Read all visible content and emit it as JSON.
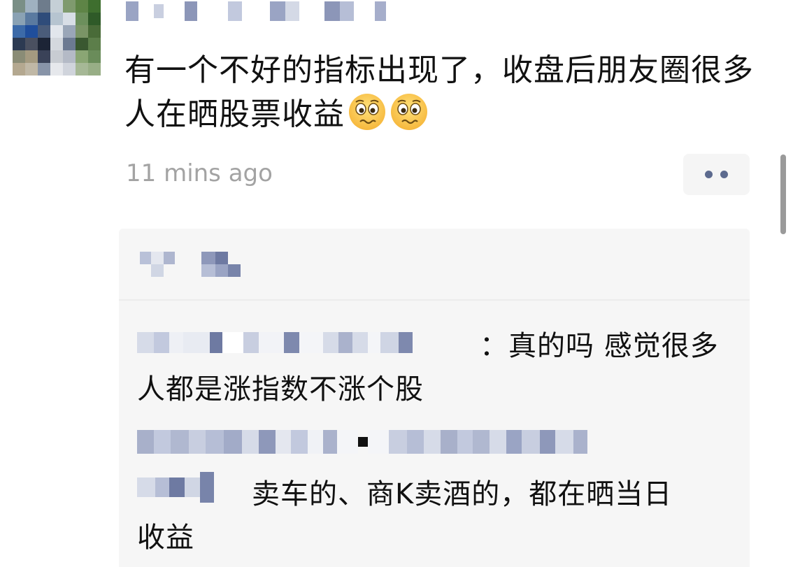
{
  "post": {
    "text": "有一个不好的指标出现了，收盘后朋友圈很多人在晒股票收益",
    "emojis": [
      "worried-face-emoji",
      "worried-face-emoji"
    ],
    "timestamp": "11 mins ago"
  },
  "comments": [
    {
      "text_line1": "：真的吗 感觉很多",
      "text_line2": "人都是涨指数不涨个股"
    },
    {
      "text_line1": "卖车的、商K卖酒的，都在晒当日",
      "text_line2": "收益"
    }
  ],
  "colors": {
    "name_link": "#576b95",
    "timestamp": "#a3a3a3",
    "panel_bg": "#f6f6f6",
    "more_dots": "#5c6a8e"
  },
  "icons": {
    "more": "more-dots-icon",
    "emoji": "worried-face-emoji"
  }
}
